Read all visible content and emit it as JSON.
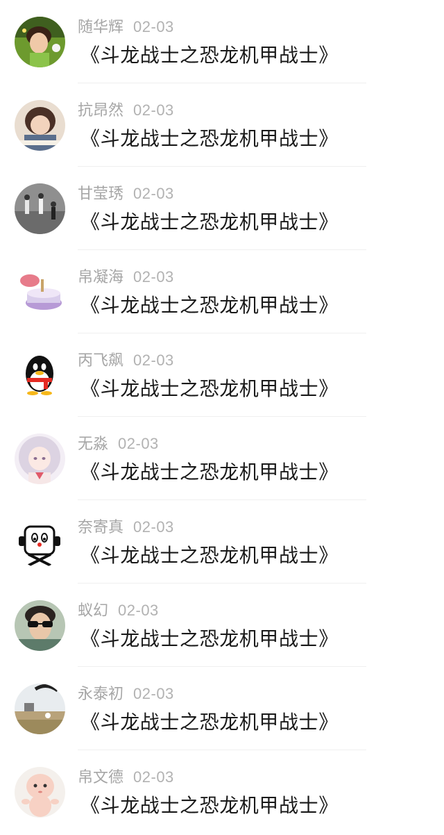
{
  "comments": [
    {
      "user": "随华辉",
      "date": "02-03",
      "text": "《斗龙战士之恐龙机甲战士》",
      "avatar": "boy-green-bg-avatar"
    },
    {
      "user": "抗昂然",
      "date": "02-03",
      "text": "《斗龙战士之恐龙机甲战士》",
      "avatar": "girl-bob-hair-avatar"
    },
    {
      "user": "甘莹琇",
      "date": "02-03",
      "text": "《斗龙战士之恐龙机甲战士》",
      "avatar": "runners-avatar"
    },
    {
      "user": "帛凝海",
      "date": "02-03",
      "text": "《斗龙战士之恐龙机甲战士》",
      "avatar": "cake-sketch-avatar"
    },
    {
      "user": "丙飞飙",
      "date": "02-03",
      "text": "《斗龙战士之恐龙机甲战士》",
      "avatar": "qq-penguin-avatar"
    },
    {
      "user": "无淼",
      "date": "02-03",
      "text": "《斗龙战士之恐龙机甲战士》",
      "avatar": "anime-girl-avatar"
    },
    {
      "user": "奈寄真",
      "date": "02-03",
      "text": "《斗龙战士之恐龙机甲战士》",
      "avatar": "cartoon-face-avatar"
    },
    {
      "user": "蚁幻",
      "date": "02-03",
      "text": "《斗龙战士之恐龙机甲战士》",
      "avatar": "sunglasses-man-avatar"
    },
    {
      "user": "永泰初",
      "date": "02-03",
      "text": "《斗龙战士之恐龙机甲战士》",
      "avatar": "field-landscape-avatar"
    },
    {
      "user": "帛文德",
      "date": "02-03",
      "text": "《斗龙战士之恐龙机甲战士》",
      "avatar": "kewpie-doll-avatar"
    }
  ],
  "colors": {
    "username": "#a6a6a6",
    "date": "#b2b2b2",
    "comment": "#1a1a1a",
    "divider": "#efefef"
  }
}
